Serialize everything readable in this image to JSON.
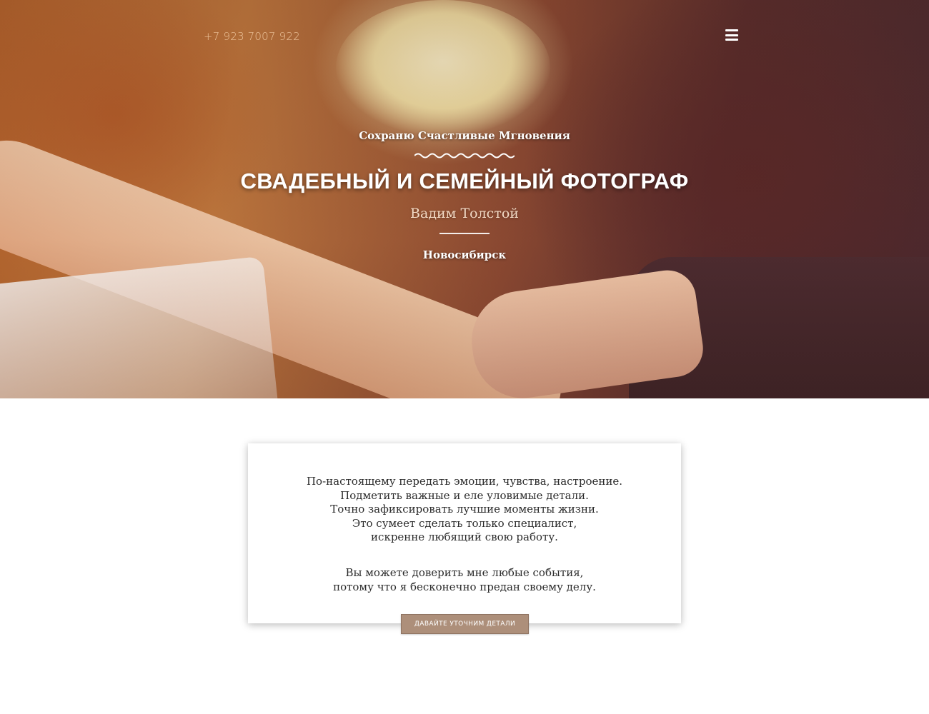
{
  "header": {
    "phone": "+7 923 7007 922",
    "menu_icon": "hamburger-menu-icon"
  },
  "hero": {
    "tagline": "Сохраню Счастливые Мгновения",
    "title": "СВАДЕБНЫЙ И СЕМЕЙНЫЙ ФОТОГРАФ",
    "name": "Вадим Толстой",
    "city": "Новосибирск"
  },
  "intro": {
    "paragraph1": [
      "По-настоящему передать эмоции, чувства, настроение.",
      "Подметить важные и еле уловимые детали.",
      "Точно зафиксировать лучшие моменты жизни.",
      "Это сумеет сделать только специалист,",
      "искренне любящий свою работу."
    ],
    "paragraph2": [
      "Вы можете доверить мне любые события,",
      "потому что я бесконечно предан своему делу."
    ],
    "cta_label": "ДАВАЙТЕ УТОЧНИМ ДЕТАЛИ"
  },
  "colors": {
    "button_bg": "#ad8f7a",
    "phone_color": "#f0c8a0"
  }
}
